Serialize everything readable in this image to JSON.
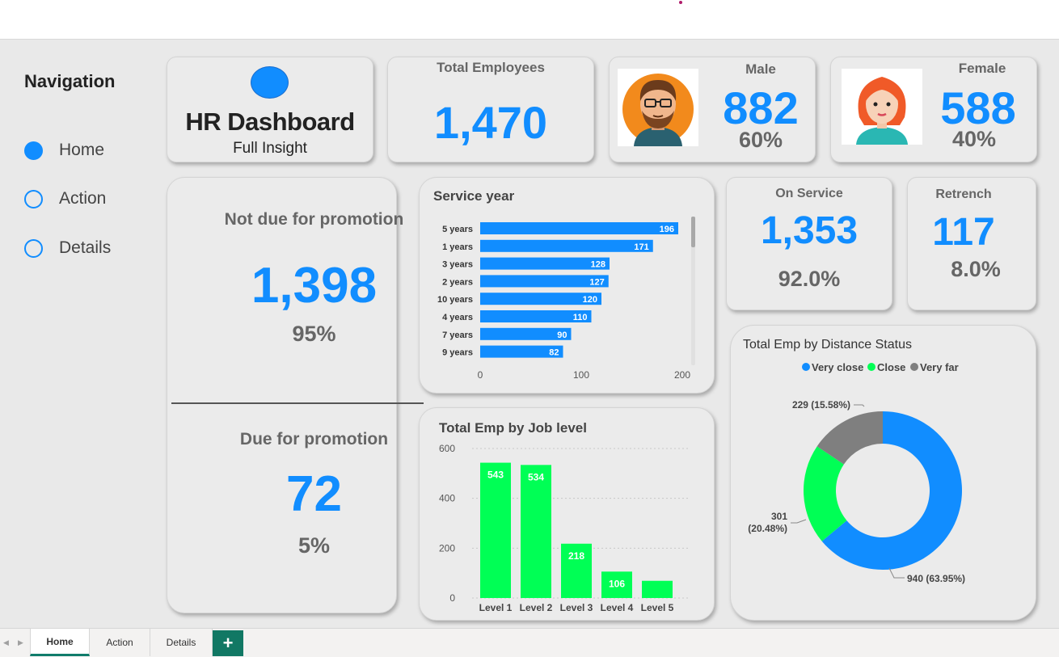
{
  "navigation": {
    "title": "Navigation",
    "items": [
      {
        "label": "Home",
        "active": true
      },
      {
        "label": "Action",
        "active": false
      },
      {
        "label": "Details",
        "active": false
      }
    ]
  },
  "header": {
    "title": "HR Dashboard",
    "subtitle": "Full Insight"
  },
  "kpi": {
    "total_employees": {
      "label": "Total Employees",
      "value": "1,470"
    },
    "male": {
      "label": "Male",
      "value": "882",
      "pct": "60%"
    },
    "female": {
      "label": "Female",
      "value": "588",
      "pct": "40%"
    },
    "on_service": {
      "label": "On Service",
      "value": "1,353",
      "pct": "92.0%"
    },
    "retrench": {
      "label": "Retrench",
      "value": "117",
      "pct": "8.0%"
    }
  },
  "promotion": {
    "not_due": {
      "label": "Not due for promotion",
      "value": "1,398",
      "pct": "95%"
    },
    "due": {
      "label": "Due for promotion",
      "value": "72",
      "pct": "5%"
    }
  },
  "colors": {
    "accent": "#118dff",
    "green": "#00ff55",
    "gray": "#7f7f7f",
    "tab_green": "#117864"
  },
  "chart_data": [
    {
      "type": "bar",
      "orientation": "horizontal",
      "title": "Service year",
      "categories": [
        "5 years",
        "1 years",
        "3 years",
        "2 years",
        "10 years",
        "4 years",
        "7 years",
        "9 years"
      ],
      "values": [
        196,
        171,
        128,
        127,
        120,
        110,
        90,
        82
      ],
      "xlim": [
        0,
        200
      ],
      "xticks": [
        "0",
        "100",
        "200"
      ],
      "color": "#118dff"
    },
    {
      "type": "bar",
      "title": "Total Emp by Job level",
      "categories": [
        "Level 1",
        "Level 2",
        "Level 3",
        "Level 4",
        "Level 5"
      ],
      "values": [
        543,
        534,
        218,
        106,
        69
      ],
      "value_labels": [
        "543",
        "534",
        "218",
        "106",
        ""
      ],
      "ylim": [
        0,
        600
      ],
      "yticks": [
        "0",
        "200",
        "400",
        "600"
      ],
      "grid": true,
      "color": "#00ff55"
    },
    {
      "type": "pie",
      "donut": true,
      "title": "Total Emp by Distance Status",
      "legend": "top",
      "slices": [
        {
          "name": "Very close",
          "value": 940,
          "label": "940 (63.95%)",
          "color": "#118dff"
        },
        {
          "name": "Close",
          "value": 301,
          "label": "301 (20.48%)",
          "color": "#00ff55"
        },
        {
          "name": "Very far",
          "value": 229,
          "label": "229 (15.58%)",
          "color": "#7f7f7f"
        }
      ]
    }
  ],
  "tabs": [
    {
      "label": "Home",
      "active": true
    },
    {
      "label": "Action",
      "active": false
    },
    {
      "label": "Details",
      "active": false
    }
  ],
  "tab_add_label": "+"
}
